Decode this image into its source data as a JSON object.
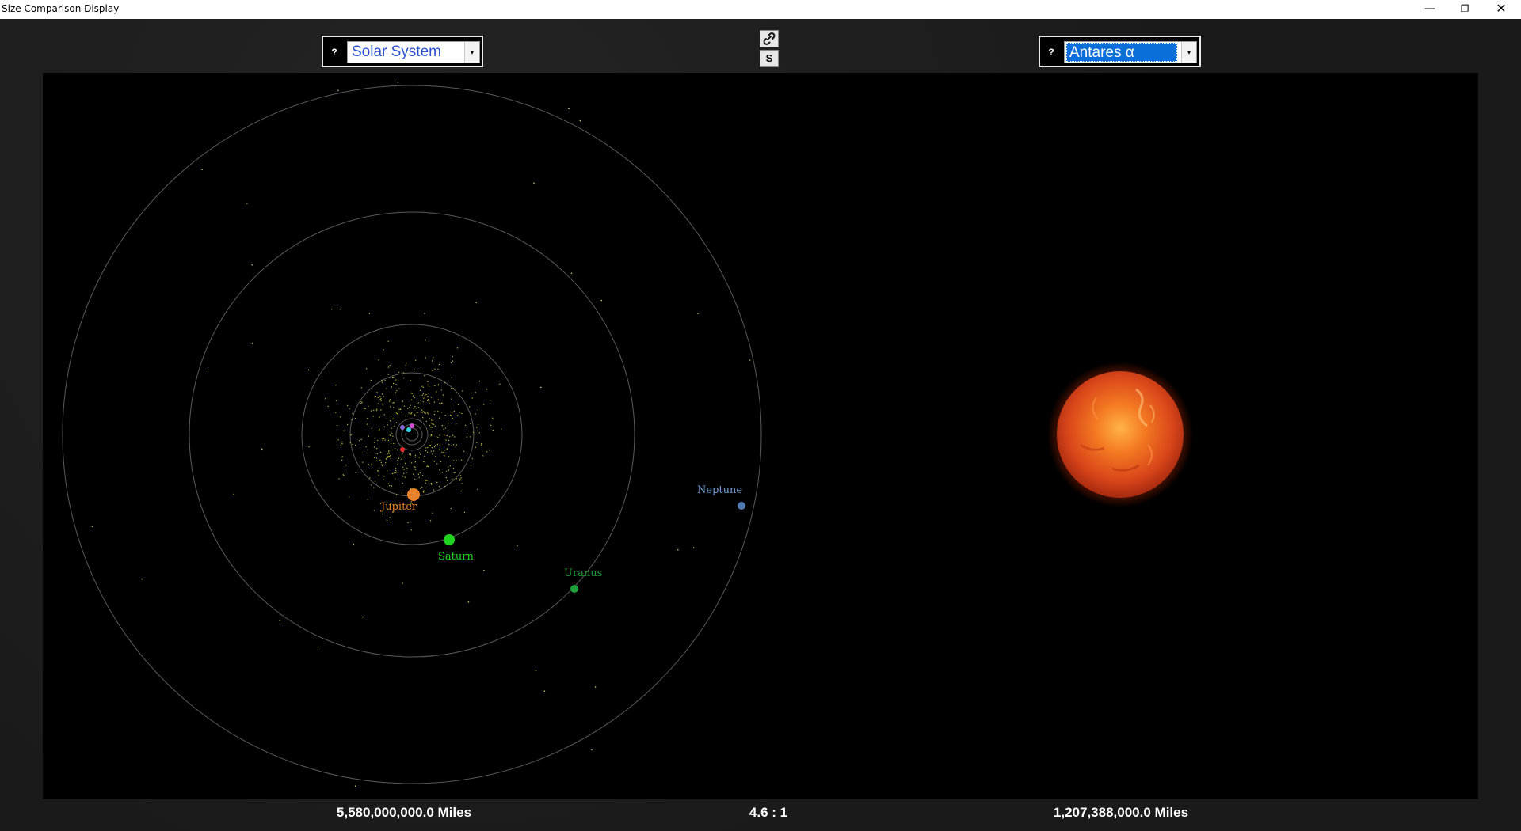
{
  "window": {
    "title": "Size Comparison Display",
    "minimize_symbol": "—",
    "restore_symbol": "❐",
    "close_symbol": "✕"
  },
  "left_selector": {
    "help_label": "?",
    "value": "Solar System"
  },
  "right_selector": {
    "help_label": "?",
    "value": "Antares α"
  },
  "center_controls": {
    "link_icon": "link-icon",
    "s_label": "S"
  },
  "left_view": {
    "planets": [
      {
        "name": "Jupiter",
        "color": "#e8822c"
      },
      {
        "name": "Saturn",
        "color": "#1fd41f"
      },
      {
        "name": "Uranus",
        "color": "#1f9f3a"
      },
      {
        "name": "Neptune",
        "color": "#4f7ab3"
      }
    ]
  },
  "right_view": {
    "object": "star",
    "color": "#e2481a"
  },
  "readouts": {
    "left_distance": "5,580,000,000.0 Miles",
    "ratio": "4.6 : 1",
    "right_distance": "1,207,388,000.0 Miles"
  }
}
